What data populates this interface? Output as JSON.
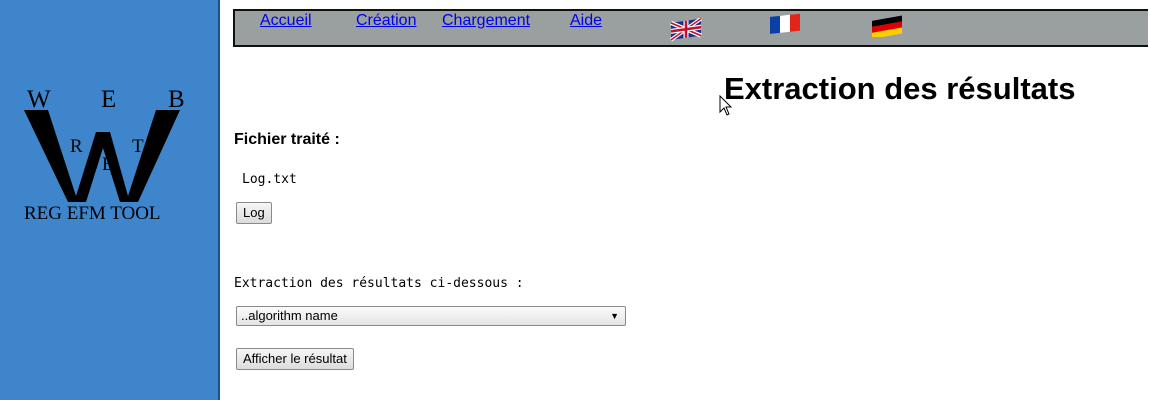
{
  "logo": {
    "letters_top": [
      "W",
      "E",
      "B"
    ],
    "letters_inner": [
      "R",
      "E",
      "T"
    ],
    "tagline": "REG EFM TOOL"
  },
  "nav": {
    "links": [
      {
        "label": "Accueil"
      },
      {
        "label": "Création"
      },
      {
        "label": "Chargement"
      },
      {
        "label": "Aide"
      }
    ],
    "flags": [
      "uk-flag-icon",
      "france-flag-icon",
      "germany-flag-icon"
    ]
  },
  "main": {
    "title": "Extraction des résultats",
    "file_label": "Fichier traité :",
    "file_name": "Log.txt",
    "log_button": "Log",
    "extract_label": "Extraction des résultats ci-dessous :",
    "algorithm_select": {
      "selected": "..algorithm name"
    },
    "show_result_button": "Afficher le résultat"
  },
  "colors": {
    "sidebar": "#3f85cb",
    "navbar": "#9aa0a0",
    "link": "#0000ee"
  }
}
